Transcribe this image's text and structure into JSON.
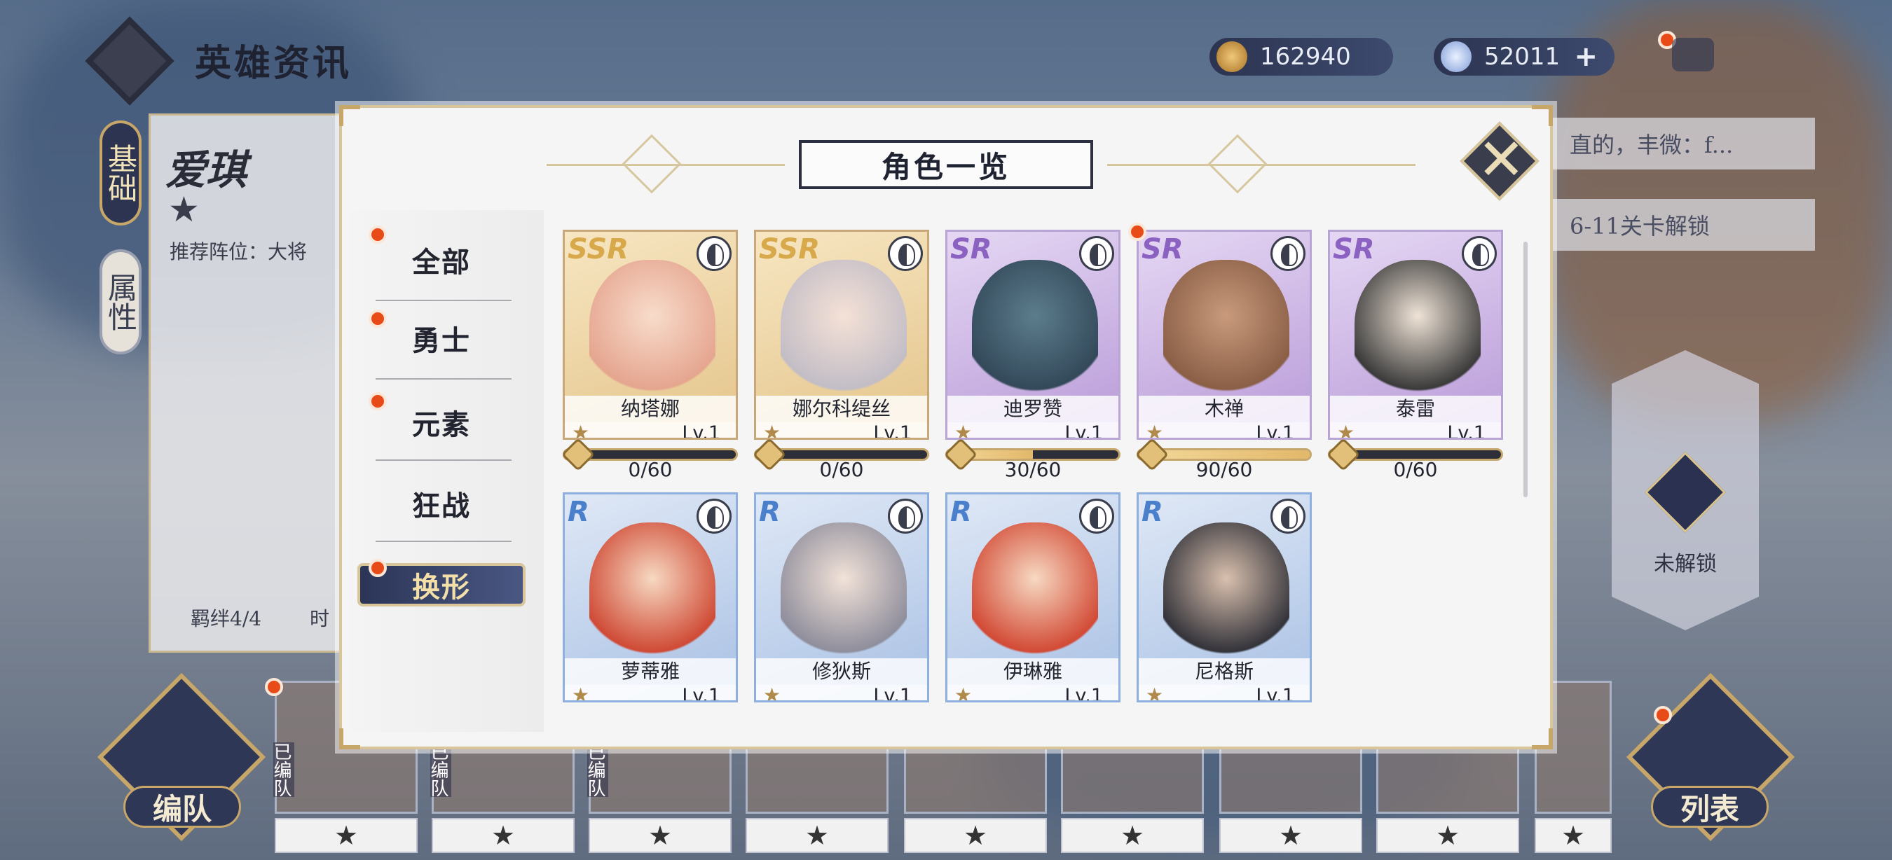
{
  "header": {
    "title": "英雄资讯",
    "currency_gold": "162940",
    "currency_gem": "52011",
    "gem_add": "+"
  },
  "side_tabs": [
    "基础",
    "属性"
  ],
  "hero_panel": {
    "name": "爱琪",
    "star": "★",
    "recommended": "推荐阵位：大将",
    "bond": "羁绊4/4",
    "bond2": "时"
  },
  "right_entries": [
    "直的，丰微：f...",
    "6-11关卡解锁"
  ],
  "locked": {
    "label": "未解锁"
  },
  "bottom_buttons": {
    "team": "编队",
    "list": "列表"
  },
  "strip": {
    "tag": "已编队",
    "star": "★"
  },
  "modal": {
    "title": "角色一览",
    "close": "✕",
    "filters": [
      {
        "label": "全部",
        "badge": true
      },
      {
        "label": "勇士",
        "badge": true
      },
      {
        "label": "元素",
        "badge": true
      },
      {
        "label": "狂战",
        "badge": false
      }
    ],
    "active_filter": {
      "label": "换形",
      "badge": true
    },
    "heroes": [
      {
        "name": "纳塔娜",
        "rarity": "SSR",
        "star": "★",
        "level": "Lv.1",
        "progress": "0/60",
        "fill": 0,
        "hue": "#f0c7b8"
      },
      {
        "name": "娜尔科缇丝",
        "rarity": "SSR",
        "star": "★",
        "level": "Lv.1",
        "progress": "0/60",
        "fill": 0,
        "hue": "#cfc7cf"
      },
      {
        "name": "迪罗赞",
        "rarity": "SR",
        "star": "★",
        "level": "Lv.1",
        "progress": "30/60",
        "fill": 0.5,
        "hue": "#4a6473"
      },
      {
        "name": "木禅",
        "rarity": "SR",
        "star": "★",
        "level": "Lv.1",
        "progress": "90/60",
        "fill": 1,
        "hue": "#b7896c",
        "badge": true
      },
      {
        "name": "泰雷",
        "rarity": "SR",
        "star": "★",
        "level": "Lv.1",
        "progress": "0/60",
        "fill": 0,
        "hue": "#d7d0c2"
      },
      {
        "name": "萝蒂雅",
        "rarity": "R",
        "star": "★",
        "level": "Lv.1",
        "hue": "#cf4a35"
      },
      {
        "name": "修狄斯",
        "rarity": "R",
        "star": "★",
        "level": "Lv.1",
        "hue": "#9c9ba9"
      },
      {
        "name": "伊琳雅",
        "rarity": "R",
        "star": "★",
        "level": "Lv.1",
        "hue": "#d24a35"
      },
      {
        "name": "尼格斯",
        "rarity": "R",
        "star": "★",
        "level": "Lv.1",
        "hue": "#7a7874"
      }
    ]
  }
}
